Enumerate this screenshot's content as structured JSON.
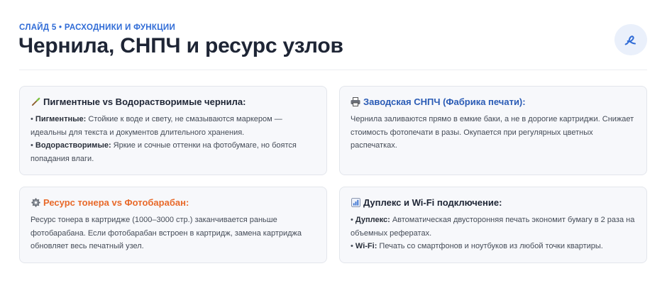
{
  "header": {
    "slide_label": "СЛАЙД 5 • РАСХОДНИКИ И ФУНКЦИИ",
    "title": "Чернила, СНПЧ и ресурс узлов",
    "badge_icon": "pen-signature-icon"
  },
  "colors": {
    "accent_blue": "#2f6bd6",
    "title_blue": "#2a5bb5",
    "accent_orange": "#e8692a",
    "card_bg": "#f7f8fb"
  },
  "cards": [
    {
      "icon": "brush-icon",
      "title": "Пигментные vs Водорастворимые чернила:",
      "items": [
        {
          "bullet": "• ",
          "bold": "Пигментные:",
          "text": " Стойкие к воде и свету, не смазываются маркером — идеальны для текста и документов длительного хранения."
        },
        {
          "bullet": "• ",
          "bold": "Водорастворимые:",
          "text": " Яркие и сочные оттенки на фотобумаге, но боятся попадания влаги."
        }
      ]
    },
    {
      "icon": "printer-icon",
      "title": "Заводская СНПЧ (Фабрика печати):",
      "body": "Чернила заливаются прямо в емкие баки, а не в дорогие картриджи. Снижает стоимость фотопечати в разы. Окупается при регулярных цветных распечатках."
    },
    {
      "icon": "gear-icon",
      "title": "Ресурс тонера vs Фотобарабан:",
      "body": "Ресурс тонера в картридже (1000–3000 стр.) заканчивается раньше фотобарабана. Если фотобарабан встроен в картридж, замена картриджа обновляет весь печатный узел."
    },
    {
      "icon": "bar-chart-icon",
      "title": "Дуплекс и Wi-Fi подключение:",
      "items": [
        {
          "bullet": "• ",
          "bold": "Дуплекс:",
          "text": " Автоматическая двусторонняя печать экономит бумагу в 2 раза на объемных рефератах."
        },
        {
          "bullet": "• ",
          "bold": "Wi-Fi:",
          "text": " Печать со смартфонов и ноутбуков из любой точки квартиры."
        }
      ]
    }
  ]
}
